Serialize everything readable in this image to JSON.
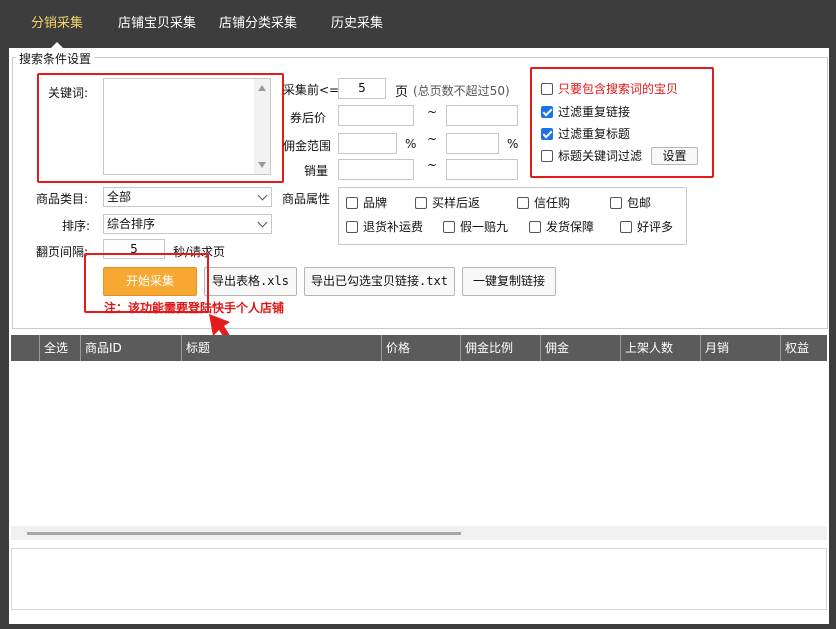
{
  "tabs": [
    {
      "label": "分销采集",
      "active": true
    },
    {
      "label": "店铺宝贝采集",
      "active": false
    },
    {
      "label": "店铺分类采集",
      "active": false
    },
    {
      "label": "历史采集",
      "active": false
    }
  ],
  "search": {
    "group_title": "搜索条件设置",
    "keyword_label": "关键词:",
    "pages_label": "采集前<=",
    "pages_value": "5",
    "pages_unit": "页",
    "pages_hint": "(总页数不超过50)",
    "coupon_price_label": "券后价",
    "commission_range_label": "佣金范围",
    "sales_label": "销量",
    "tilde": "~",
    "percent": "%",
    "category_label": "商品类目:",
    "category_value": "全部",
    "sort_label": "排序:",
    "sort_value": "综合排序",
    "interval_label": "翻页间隔:",
    "interval_value": "5",
    "interval_unit": "秒/请求页",
    "attrs_label": "商品属性"
  },
  "filters": {
    "only_keyword": {
      "label": "只要包含搜索词的宝贝",
      "checked": false
    },
    "dedupe_link": {
      "label": "过滤重复链接",
      "checked": true
    },
    "dedupe_title": {
      "label": "过滤重复标题",
      "checked": true
    },
    "title_keyword": {
      "label": "标题关键词过滤",
      "checked": false
    },
    "settings_label": "设置"
  },
  "attrs": [
    {
      "label": "品牌",
      "checked": false
    },
    {
      "label": "买样后返",
      "checked": false
    },
    {
      "label": "信任购",
      "checked": false
    },
    {
      "label": "包邮",
      "checked": false
    },
    {
      "label": "退货补运费",
      "checked": false
    },
    {
      "label": "假一赔九",
      "checked": false
    },
    {
      "label": "发货保障",
      "checked": false
    },
    {
      "label": "好评多",
      "checked": false
    }
  ],
  "actions": {
    "start": "开始采集",
    "export_xls": "导出表格.xls",
    "export_txt": "导出已勾选宝贝链接.txt",
    "copy_links": "一键复制链接"
  },
  "note": "注：该功能需要登陆快手个人店铺",
  "table": {
    "columns": [
      "全选",
      "商品ID",
      "标题",
      "价格",
      "佣金比例",
      "佣金",
      "上架人数",
      "月销",
      "权益"
    ]
  },
  "colors": {
    "highlight_red": "#e31b1b",
    "accent_orange": "#f6a833",
    "check_blue": "#1a73e8",
    "tab_active": "#f5d36b"
  }
}
